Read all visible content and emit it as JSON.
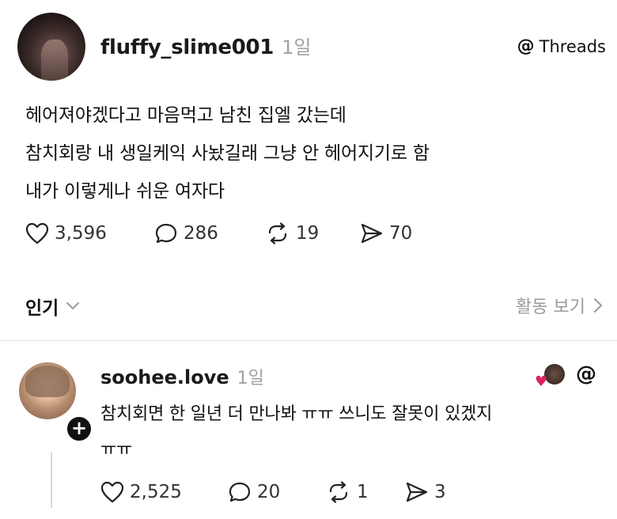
{
  "post": {
    "username": "fluffy_slime001",
    "time": "1일",
    "badge": "Threads",
    "lines": [
      "헤어져야겠다고 마음먹고 남친 집엘 갔는데",
      "참치회랑 내 생일케익 사놨길래 그냥 안 헤어지기로 함",
      "내가 이렇게나 쉬운 여자다"
    ],
    "likes": "3,596",
    "comments": "286",
    "reposts": "19",
    "shares": "70"
  },
  "sort": {
    "label": "인기",
    "activity": "활동 보기"
  },
  "reply": {
    "username": "soohee.love",
    "time": "1일",
    "line1": "참치회면 한 일년 더 만나봐 ㅠㅠ 쓰니도 잘못이 있겠지",
    "line2": "ㅠㅠ",
    "likes": "2,525",
    "comments": "20",
    "reposts": "1",
    "shares": "3"
  },
  "icons": {
    "threads": "threads-logo-icon",
    "like": "heart-icon",
    "comment": "comment-bubble-icon",
    "repost": "repost-icon",
    "share": "send-icon",
    "chevron_down": "chevron-down-icon",
    "chevron_right": "chevron-right-icon",
    "plus": "plus-icon"
  },
  "colors": {
    "text": "#111111",
    "muted": "#a0a0a0",
    "like_heart": "#e0245e"
  }
}
